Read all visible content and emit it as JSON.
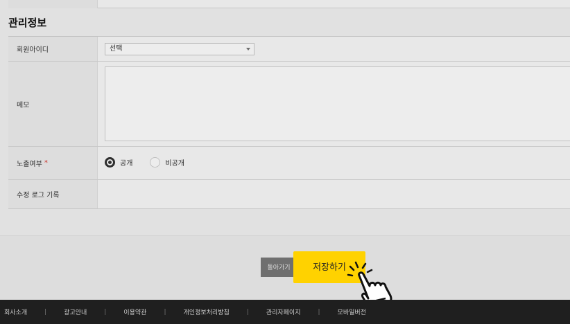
{
  "section": {
    "title": "관리정보"
  },
  "form": {
    "member_id": {
      "label": "회원아이디",
      "selected": "선택"
    },
    "memo": {
      "label": "메모",
      "value": ""
    },
    "visibility": {
      "label": "노출여부",
      "required_mark": "*",
      "options": [
        {
          "label": "공개",
          "checked": true
        },
        {
          "label": "비공개",
          "checked": false
        }
      ]
    },
    "edit_log": {
      "label": "수정 로그 기록"
    }
  },
  "actions": {
    "back_label": "돌아가기",
    "save_label": "저장하기"
  },
  "footer": {
    "links": [
      "회사소개",
      "광고안내",
      "이용약관",
      "개인정보처리방침",
      "관리자페이지",
      "모바일버전"
    ],
    "separator": "|"
  },
  "colors": {
    "save_button": "#ffd200",
    "footer_bg": "#1f1f1f",
    "required": "#d9342b"
  },
  "icons": {
    "cursor": "pointing-hand-icon"
  }
}
